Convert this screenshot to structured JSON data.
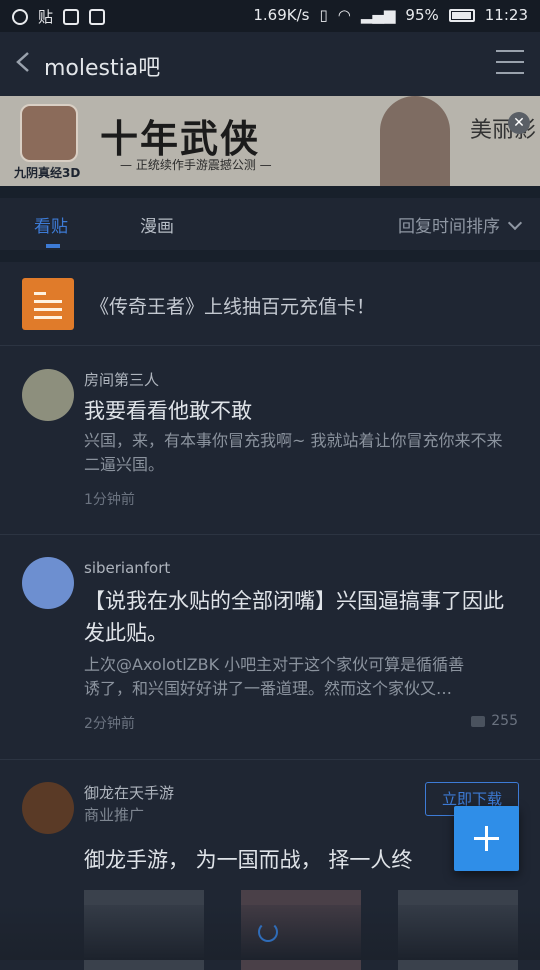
{
  "status_bar": {
    "left_icons": [
      "qq-icon",
      "tieba-icon",
      "trash-icon",
      "image-icon"
    ],
    "tieba_label": "贴",
    "speed": "1.69K/s",
    "battery": "95%",
    "time": "11:23"
  },
  "nav": {
    "title": "molestia吧"
  },
  "banner": {
    "game_name": "九阴真经3D",
    "headline": "十年武侠",
    "tagline": "— 正统续作手游震撼公测 —",
    "signature": "美丽影"
  },
  "tabs": {
    "items": [
      "看贴",
      "漫画"
    ],
    "active_index": 0,
    "sort_label": "回复时间排序"
  },
  "announcement": {
    "text": "《传奇王者》上线抽百元充值卡！"
  },
  "posts": [
    {
      "author": "房间第三人",
      "title": "我要看看他敢不敢",
      "body": "兴国，来，有本事你冒充我啊~ 我就站着让你冒充你来不来 二逼兴国。",
      "time": "1分钟前"
    },
    {
      "author": "siberianfort",
      "title": "【说我在水贴的全部闭嘴】兴国逼搞事了因此发此贴。",
      "body_line1": "上次@AxolotlZBK 小吧主对于这个家伙可算是循循善",
      "body_line2": "诱了，和兴国好好讲了一番道理。然而这个家伙又…",
      "time": "2分钟前",
      "comments": "255"
    }
  ],
  "ad": {
    "author": "御龙在天手游",
    "label": "商业推广",
    "button": "立即下载",
    "title": "御龙手游， 为一国而战， 择一人终"
  },
  "colors": {
    "accent": "#3d7bd6",
    "fab": "#2f8ee8",
    "announce_icon": "#e07b2a",
    "background": "#1f2633"
  }
}
